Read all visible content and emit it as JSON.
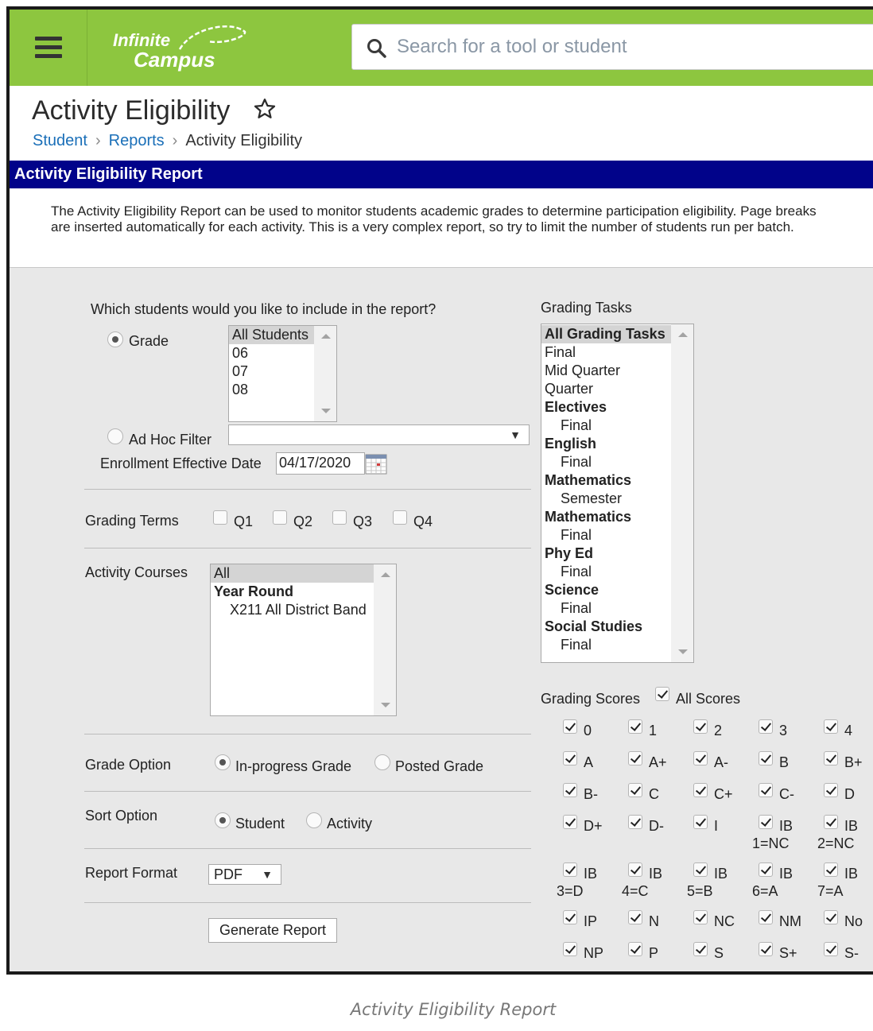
{
  "header": {
    "logo_line1": "Infinite",
    "logo_line2": "Campus",
    "search_placeholder": "Search for a tool or student"
  },
  "page": {
    "title": "Activity Eligibility",
    "breadcrumb": [
      "Student",
      "Reports",
      "Activity Eligibility"
    ]
  },
  "section_title": "Activity Eligibility Report",
  "description": "The Activity Eligibility Report can be used to monitor students academic grades to determine participation eligibility. Page breaks are inserted automatically for each activity. This is a very complex report, so try to limit the number of students run per batch.",
  "students": {
    "question": "Which students would you like to include in the report?",
    "grade_label": "Grade",
    "grade_options": [
      "All Students",
      "06",
      "07",
      "08"
    ],
    "adhoc_label": "Ad Hoc Filter",
    "adhoc_value": "",
    "date_label": "Enrollment Effective Date",
    "date_value": "04/17/2020"
  },
  "grading_terms": {
    "label": "Grading Terms",
    "terms": [
      "Q1",
      "Q2",
      "Q3",
      "Q4"
    ]
  },
  "activity_courses": {
    "label": "Activity Courses",
    "items": [
      "All",
      "Year Round",
      "X211 All District Band"
    ]
  },
  "grade_option": {
    "label": "Grade Option",
    "options": [
      "In-progress Grade",
      "Posted Grade"
    ]
  },
  "sort_option": {
    "label": "Sort Option",
    "options": [
      "Student",
      "Activity"
    ]
  },
  "report_format": {
    "label": "Report Format",
    "value": "PDF"
  },
  "generate_label": "Generate Report",
  "grading_tasks": {
    "label": "Grading Tasks",
    "items": [
      "All Grading Tasks",
      "Final",
      "Mid Quarter",
      "Quarter",
      "Electives",
      "Final",
      "English",
      "Final",
      "Mathematics",
      "Semester",
      "Mathematics",
      "Final",
      "Phy Ed",
      "Final",
      "Science",
      "Final",
      "Social Studies",
      "Final"
    ]
  },
  "grading_scores": {
    "label": "Grading Scores",
    "all_label": "All Scores",
    "rows": [
      [
        [
          "0",
          ""
        ],
        [
          "1",
          ""
        ],
        [
          "2",
          ""
        ],
        [
          "3",
          ""
        ],
        [
          "4",
          ""
        ]
      ],
      [
        [
          "A",
          ""
        ],
        [
          "A+",
          ""
        ],
        [
          "A-",
          ""
        ],
        [
          "B",
          ""
        ],
        [
          "B+",
          ""
        ]
      ],
      [
        [
          "B-",
          ""
        ],
        [
          "C",
          ""
        ],
        [
          "C+",
          ""
        ],
        [
          "C-",
          ""
        ],
        [
          "D",
          ""
        ]
      ],
      [
        [
          "D+",
          ""
        ],
        [
          "D-",
          ""
        ],
        [
          "I",
          ""
        ],
        [
          "IB",
          "1=NC"
        ],
        [
          "IB",
          "2=NC"
        ]
      ],
      [
        [
          "IB",
          "3=D"
        ],
        [
          "IB",
          "4=C"
        ],
        [
          "IB",
          "5=B"
        ],
        [
          "IB",
          "6=A"
        ],
        [
          "IB",
          "7=A"
        ]
      ],
      [
        [
          "IP",
          ""
        ],
        [
          "N",
          ""
        ],
        [
          "NC",
          ""
        ],
        [
          "NM",
          ""
        ],
        [
          "No",
          ""
        ]
      ],
      [
        [
          "NP",
          ""
        ],
        [
          "P",
          ""
        ],
        [
          "S",
          ""
        ],
        [
          "S+",
          ""
        ],
        [
          "S-",
          ""
        ]
      ]
    ]
  },
  "caption": "Activity Eligibility Report"
}
